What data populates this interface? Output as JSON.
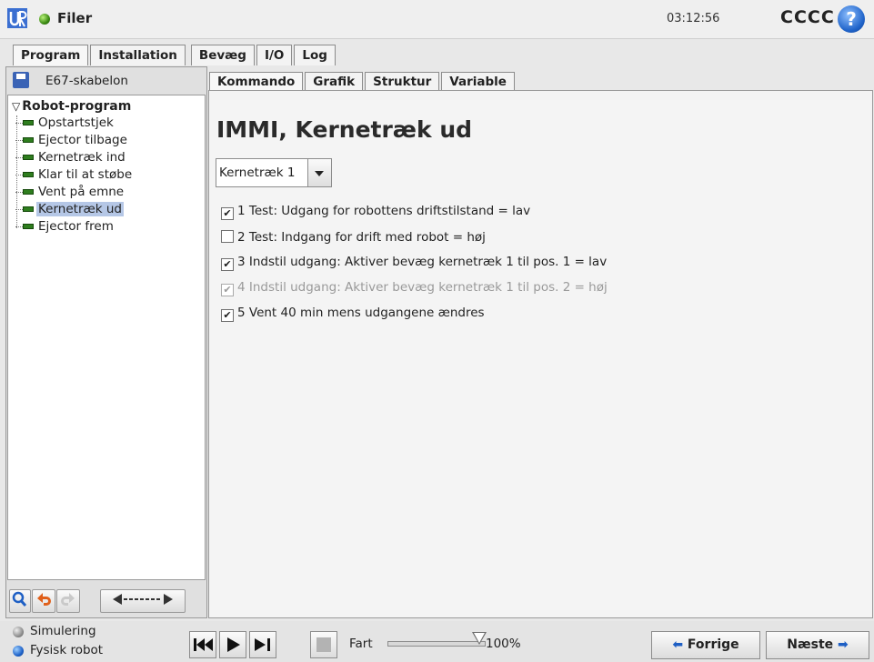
{
  "titlebar": {
    "app_title": "Filer",
    "clock": "03:12:56",
    "robot_name": "CCCC",
    "help_label": "?"
  },
  "main_tabs": [
    {
      "label": "Program",
      "active": true
    },
    {
      "label": "Installation",
      "active": false
    },
    {
      "label": "Bevæg",
      "active": false
    },
    {
      "label": "I/O",
      "active": false
    },
    {
      "label": "Log",
      "active": false
    }
  ],
  "left_panel": {
    "file_name": "E67-skabelon",
    "tree": {
      "root": "Robot-program",
      "items": [
        {
          "label": "Opstartstjek",
          "selected": false
        },
        {
          "label": "Ejector tilbage",
          "selected": false
        },
        {
          "label": "Kernetræk ind",
          "selected": false
        },
        {
          "label": "Klar til at støbe",
          "selected": false
        },
        {
          "label": "Vent på emne",
          "selected": false
        },
        {
          "label": "Kernetræk ud",
          "selected": true
        },
        {
          "label": "Ejector frem",
          "selected": false
        }
      ]
    }
  },
  "sub_tabs": [
    {
      "label": "Kommando",
      "active": true
    },
    {
      "label": "Grafik",
      "active": false
    },
    {
      "label": "Struktur",
      "active": false
    },
    {
      "label": "Variable",
      "active": false
    }
  ],
  "content": {
    "title": "IMMI, Kernetræk ud",
    "select_value": "Kernetræk 1",
    "checks": [
      {
        "label": "1 Test: Udgang for robottens driftstilstand = lav",
        "checked": true,
        "enabled": true
      },
      {
        "label": "2 Test: Indgang for drift med robot = høj",
        "checked": false,
        "enabled": true
      },
      {
        "label": "3 Indstil udgang: Aktiver bevæg kernetræk 1 til pos. 1 = lav",
        "checked": true,
        "enabled": true
      },
      {
        "label": "4 Indstil udgang: Aktiver bevæg kernetræk 1 til pos. 2 = høj",
        "checked": true,
        "enabled": false
      },
      {
        "label": "5 Vent 40 min mens udgangene ændres",
        "checked": true,
        "enabled": true
      }
    ]
  },
  "bottombar": {
    "mode_simulation": "Simulering",
    "mode_real": "Fysisk robot",
    "speed_label": "Fart",
    "speed_value": "100%",
    "speed_fraction": 1.0,
    "prev_label": "Forrige",
    "next_label": "Næste"
  }
}
